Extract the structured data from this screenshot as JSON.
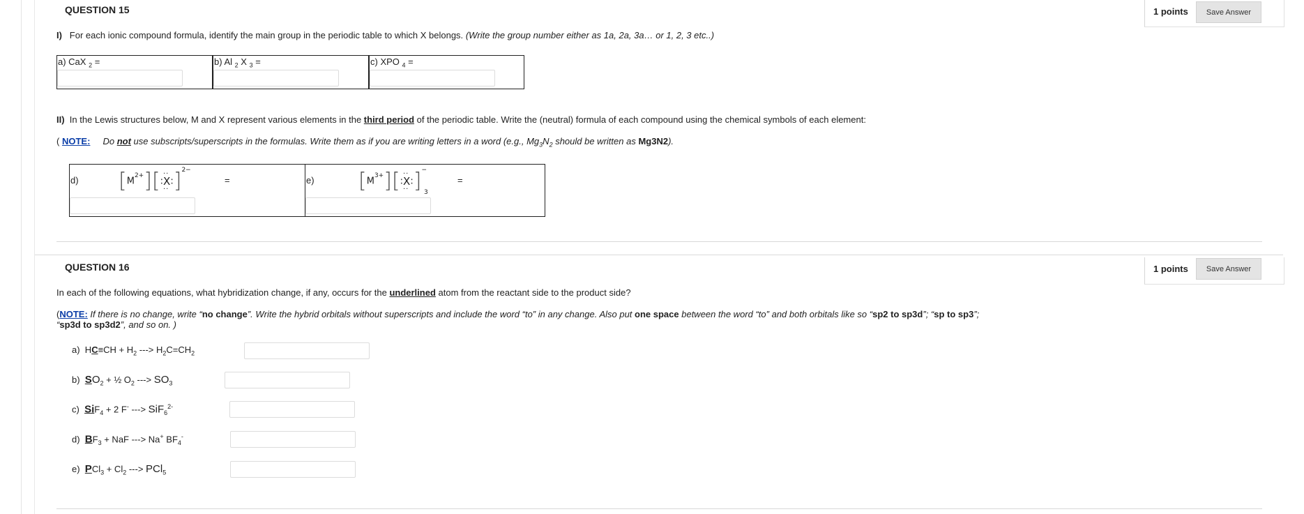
{
  "q15": {
    "title": "QUESTION 15",
    "points": "1 points",
    "save": "Save Answer",
    "part1_label": "I)",
    "part1_text": "For each ionic compound formula, identify the main group in the periodic table to which X belongs.",
    "part1_hint": "(Write the group number either as 1a,  2a, 3a… or 1, 2, 3 etc..)",
    "cells": [
      {
        "label": "a) CaX",
        "sub": "2",
        "tail": " ="
      },
      {
        "label": "b) Al",
        "sub": "2",
        "mid": " X",
        "sub2": "3",
        "tail": " ="
      },
      {
        "label": "c) XPO",
        "sub": "4",
        "tail": " ="
      }
    ],
    "part2_label": "II)",
    "part2_text_a": "In the Lewis structures below, M and X represent various elements in the ",
    "part2_emph": "third period",
    "part2_text_b": " of the periodic table. Write the (neutral) formula of each compound using the chemical symbols of each element:",
    "note_open": "(",
    "note_label": "NOTE:",
    "note_a": "Do ",
    "note_not": "not",
    "note_b": " use subscripts/superscripts in the formulas. Write them as if you are writing letters in a word (e.g., Mg",
    "note_sub1": "3",
    "note_mid": "N",
    "note_sub2": "2",
    "note_c": " should be written as ",
    "note_example": "Mg3N2",
    "note_end": ").",
    "lewis": [
      {
        "label": "d)",
        "metal": "M",
        "metal_charge": "2+",
        "anion": "X",
        "anion_charge": "2−",
        "count": "",
        "eq": "="
      },
      {
        "label": "e)",
        "metal": "M",
        "metal_charge": "3+",
        "anion": "X",
        "anion_charge": "−",
        "count": "3",
        "eq": "="
      }
    ]
  },
  "q16": {
    "title": "QUESTION 16",
    "points": "1 points",
    "save": "Save Answer",
    "intro_a": "In each of the following equations, what hybridization change, if any, occurs for the ",
    "intro_emph": "underlined",
    "intro_b": " atom from the reactant side to the product side?",
    "note_open": "(",
    "note_label": "NOTE:",
    "note_a": " If there is no change, write “",
    "note_nochange": "no change",
    "note_b": "”. Write the hybrid orbitals without superscripts and include the word “to” in any change. Also put ",
    "note_space": "one space",
    "note_c": " between the word “to” and both orbitals like so “",
    "note_ex1": "sp2 to sp3d",
    "note_d": "”; “",
    "note_ex2": "sp to sp3",
    "note_e": "”;",
    "note_line2_a": "“",
    "note_ex3": "sp3d to sp3d2",
    "note_line2_b": "”, and so on. )",
    "eqs": [
      {
        "label": "a)",
        "under": "C",
        "pre": "H",
        "rest": "≡CH + H",
        "s1": "2",
        "arrow": " ---> ",
        "prod": "H",
        "ps1": "2",
        "prod2": "C=CH",
        "ps2": "2"
      },
      {
        "label": "b)",
        "under": "S",
        "rest": "O",
        "s1": "2",
        "rest2": " + ½ O",
        "s2": "2",
        "arrow": " ---> ",
        "prod": "SO",
        "ps1": "3"
      },
      {
        "label": "c)",
        "under": "Si",
        "rest": "F",
        "s1": "4",
        "rest2": " + 2 F",
        "sup2": "-",
        "arrow": " ---> ",
        "prod": "SiF",
        "ps1": "6",
        "psup": "2-"
      },
      {
        "label": "d)",
        "under": "B",
        "rest": "F",
        "s1": "3",
        "rest2": " + NaF ---> Na",
        "sup2": "+",
        "prod": " BF",
        "ps1": "4",
        "psup": "-"
      },
      {
        "label": "e)",
        "under": "P",
        "rest": "Cl",
        "s1": "3",
        "rest2": " + Cl",
        "s2": "2",
        "arrow": " ---> ",
        "prod": "PCl",
        "ps1": "5"
      }
    ]
  }
}
